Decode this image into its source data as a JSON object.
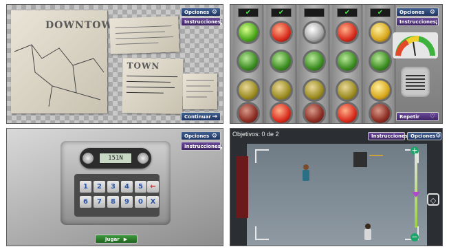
{
  "buttons": {
    "opciones": "Opciones",
    "instrucciones": "Instrucciones",
    "continuar": "Continuar",
    "repetir": "Repetir",
    "jugar": "Jugar"
  },
  "newspaper": {
    "title_top": "DOWNTOWN",
    "title_mid": "TOWN"
  },
  "lights": {
    "checks": [
      "✔",
      "✔",
      "",
      "✔",
      "✔"
    ]
  },
  "safe": {
    "display": "151N",
    "keys": [
      "1",
      "2",
      "3",
      "4",
      "5",
      "6",
      "7",
      "8",
      "9",
      "0"
    ],
    "backspace": "←",
    "cancel": "X"
  },
  "level": {
    "objectives": "Objetivos: 0 de 2"
  },
  "icons": {
    "gear": "⚙",
    "info": "i",
    "arrow": "→",
    "play": "▶"
  },
  "colors": {
    "button_blue": "#1f3563",
    "button_purple": "#3d2363",
    "button_green": "#2a7a2a"
  }
}
